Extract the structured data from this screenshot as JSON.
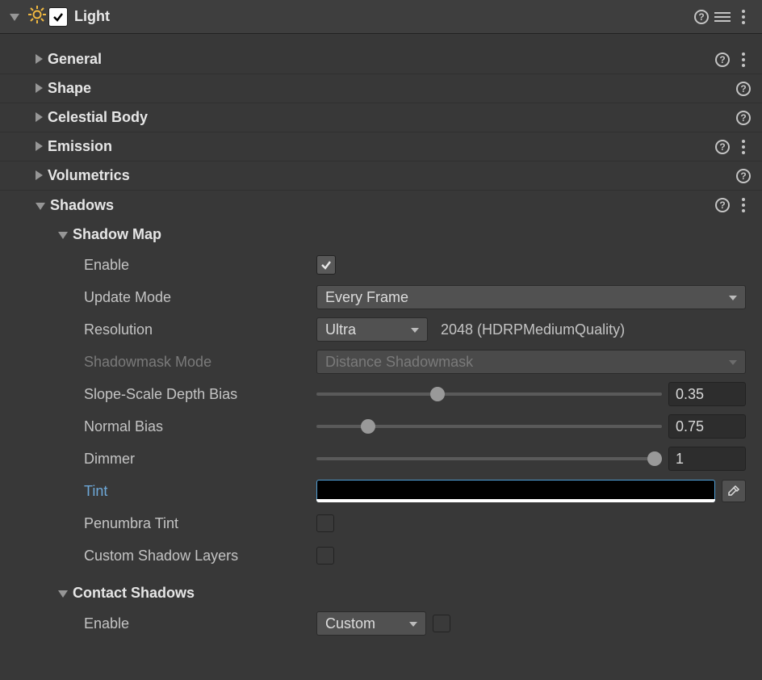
{
  "component": {
    "name": "Light",
    "enabled": true
  },
  "sections": {
    "general": "General",
    "shape": "Shape",
    "celestial": "Celestial Body",
    "emission": "Emission",
    "volumetrics": "Volumetrics",
    "shadows": "Shadows"
  },
  "shadowMap": {
    "header": "Shadow Map",
    "enable": {
      "label": "Enable",
      "checked": true
    },
    "updateMode": {
      "label": "Update Mode",
      "value": "Every Frame"
    },
    "resolution": {
      "label": "Resolution",
      "value": "Ultra",
      "detail": "2048 (HDRPMediumQuality)"
    },
    "shadowmaskMode": {
      "label": "Shadowmask Mode",
      "value": "Distance Shadowmask"
    },
    "slopeScaleDepthBias": {
      "label": "Slope-Scale Depth Bias",
      "value": "0.35",
      "percent": 35
    },
    "normalBias": {
      "label": "Normal Bias",
      "value": "0.75",
      "percent": 15
    },
    "dimmer": {
      "label": "Dimmer",
      "value": "1",
      "percent": 98
    },
    "tint": {
      "label": "Tint",
      "color": "#000000"
    },
    "penumbraTint": {
      "label": "Penumbra Tint",
      "checked": false
    },
    "customShadowLayers": {
      "label": "Custom Shadow Layers",
      "checked": false
    }
  },
  "contactShadows": {
    "header": "Contact Shadows",
    "enable": {
      "label": "Enable",
      "value": "Custom",
      "checked": false
    }
  }
}
